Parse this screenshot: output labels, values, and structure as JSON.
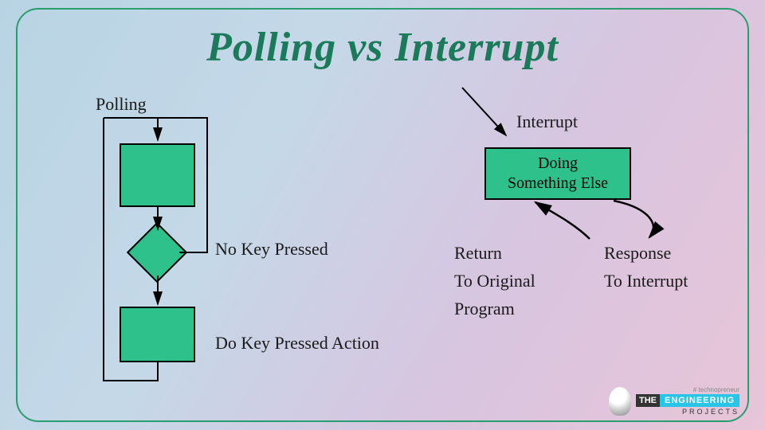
{
  "title": "Polling vs Interrupt",
  "polling": {
    "heading": "Polling",
    "no_key": "No Key Pressed",
    "do_key": "Do Key Pressed Action"
  },
  "interrupt": {
    "heading": "Interrupt",
    "doing_line1": "Doing",
    "doing_line2": "Something Else",
    "return_line1": "Return",
    "return_line2": "To Original",
    "return_line3": "Program",
    "response_line1": "Response",
    "response_line2": "To Interrupt"
  },
  "logo": {
    "hash": "# technopreneur",
    "the": "THE",
    "eng": "ENGINEERING",
    "proj": "PROJECTS"
  },
  "colors": {
    "accent": "#2fc18c",
    "title": "#1a7a5a",
    "border": "#2a9d6f"
  }
}
